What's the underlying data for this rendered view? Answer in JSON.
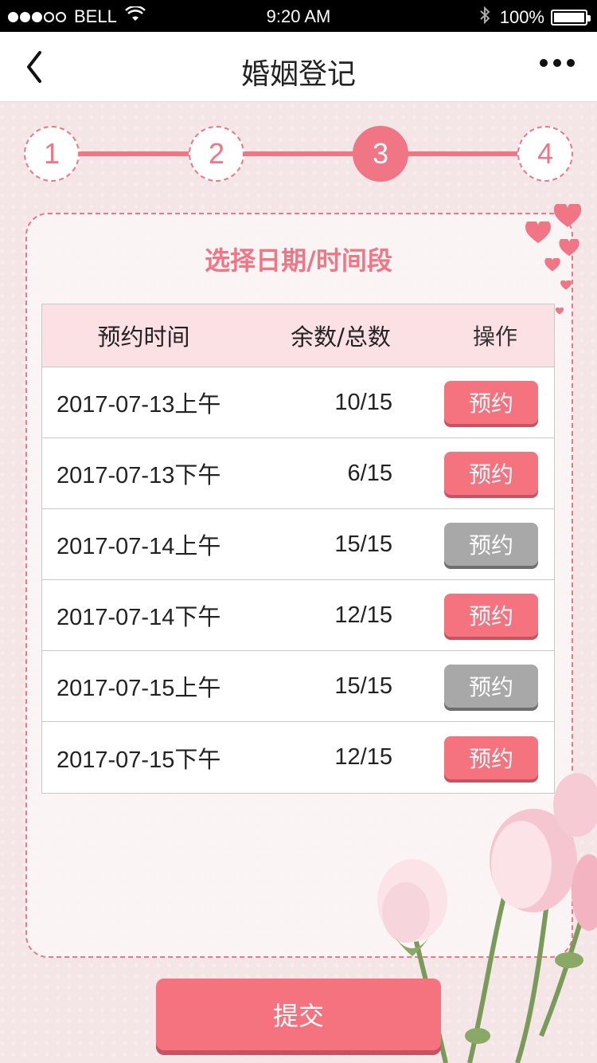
{
  "status_bar": {
    "signal_dots": 5,
    "signal_filled": 3,
    "carrier": "BELL",
    "wifi_icon": "wifi-icon",
    "time": "9:20 AM",
    "bluetooth_icon": "bluetooth-icon",
    "battery": "100%"
  },
  "nav": {
    "title": "婚姻登记",
    "back_icon": "chevron-left-icon",
    "more_icon": "more-icon"
  },
  "stepper": {
    "steps": [
      "1",
      "2",
      "3",
      "4"
    ],
    "active_step": 3
  },
  "card": {
    "title": "选择日期/时间段"
  },
  "table": {
    "headers": [
      "预约时间",
      "余数/总数",
      "操作"
    ],
    "rows": [
      {
        "time": "2017-07-13上午",
        "count": "10/15",
        "action": "预约",
        "enabled": true
      },
      {
        "time": "2017-07-13下午",
        "count": "6/15",
        "action": "预约",
        "enabled": true
      },
      {
        "time": "2017-07-14上午",
        "count": "15/15",
        "action": "预约",
        "enabled": false
      },
      {
        "time": "2017-07-14下午",
        "count": "12/15",
        "action": "预约",
        "enabled": true
      },
      {
        "time": "2017-07-15上午",
        "count": "15/15",
        "action": "预约",
        "enabled": false
      },
      {
        "time": "2017-07-15下午",
        "count": "12/15",
        "action": "预约",
        "enabled": true
      }
    ]
  },
  "submit": {
    "label": "提交"
  },
  "colors": {
    "accent": "#f07585",
    "button": "#f5727f",
    "disabled": "#a8a8a8",
    "header_bg": "#fbe0e4",
    "page_bg": "#f4e6e6"
  }
}
